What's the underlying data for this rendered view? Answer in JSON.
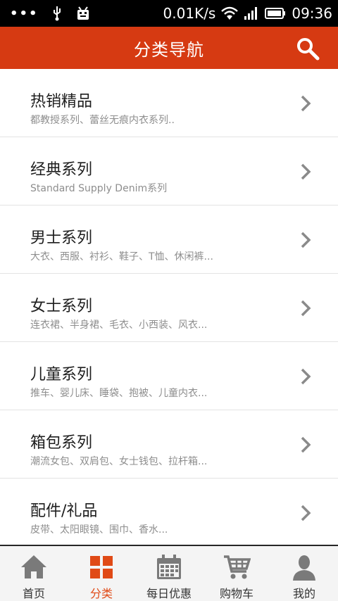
{
  "status_bar": {
    "dots": "•••",
    "network_speed": "0.01K/s",
    "time": "09:36"
  },
  "header": {
    "title": "分类导航",
    "search_icon": "search-icon"
  },
  "categories": [
    {
      "title": "热销精品",
      "subtitle": "都教授系列、蕾丝无痕内衣系列.."
    },
    {
      "title": "经典系列",
      "subtitle": "Standard Supply Denim系列"
    },
    {
      "title": "男士系列",
      "subtitle": "大衣、西服、衬衫、鞋子、T恤、休闲裤..."
    },
    {
      "title": "女士系列",
      "subtitle": "连衣裙、半身裙、毛衣、小西装、风衣..."
    },
    {
      "title": "儿童系列",
      "subtitle": "推车、婴儿床、睡袋、抱被、儿童内衣..."
    },
    {
      "title": "箱包系列",
      "subtitle": "潮流女包、双肩包、女士钱包、拉杆箱..."
    },
    {
      "title": "配件/礼品",
      "subtitle": "皮带、太阳眼镜、围巾、香水..."
    }
  ],
  "tabs": [
    {
      "label": "首页",
      "icon": "home-icon",
      "active": false
    },
    {
      "label": "分类",
      "icon": "grid-icon",
      "active": true
    },
    {
      "label": "每日优惠",
      "icon": "calendar-icon",
      "active": false
    },
    {
      "label": "购物车",
      "icon": "cart-icon",
      "active": false
    },
    {
      "label": "我的",
      "icon": "user-icon",
      "active": false
    }
  ],
  "colors": {
    "accent": "#d63a12",
    "active_tab": "#e04a16",
    "inactive_icon": "#7a7a7a"
  }
}
